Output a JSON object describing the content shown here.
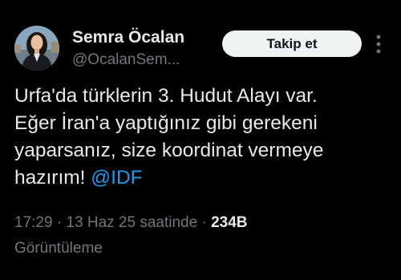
{
  "colors": {
    "background": "#000000",
    "primary_text": "#e7e9ea",
    "secondary_text": "#71767b",
    "link": "#1d9bf0",
    "follow_button_bg": "#eff3f4",
    "follow_button_text": "#0f1419"
  },
  "author": {
    "display_name": "Semra Öcalan",
    "handle": "@OcalanSem...",
    "avatar_icon": "profile-photo"
  },
  "header": {
    "follow_label": "Takip et",
    "more_icon": "more-vertical-icon"
  },
  "tweet": {
    "line1": "Urfa'da türklerin 3. Hudut Alayı var.",
    "line2": "Eğer İran'a yaptığınız gibi gerekeni",
    "line3": "yaparsanız, size koordinat vermeye",
    "line4_text": "hazırım! ",
    "mention": "@IDF"
  },
  "meta": {
    "time": "17:29",
    "separator1": " · ",
    "date": "13 Haz 25 saatinde",
    "separator2": " · ",
    "views_count": "234B",
    "views_label": "Görüntüleme"
  }
}
